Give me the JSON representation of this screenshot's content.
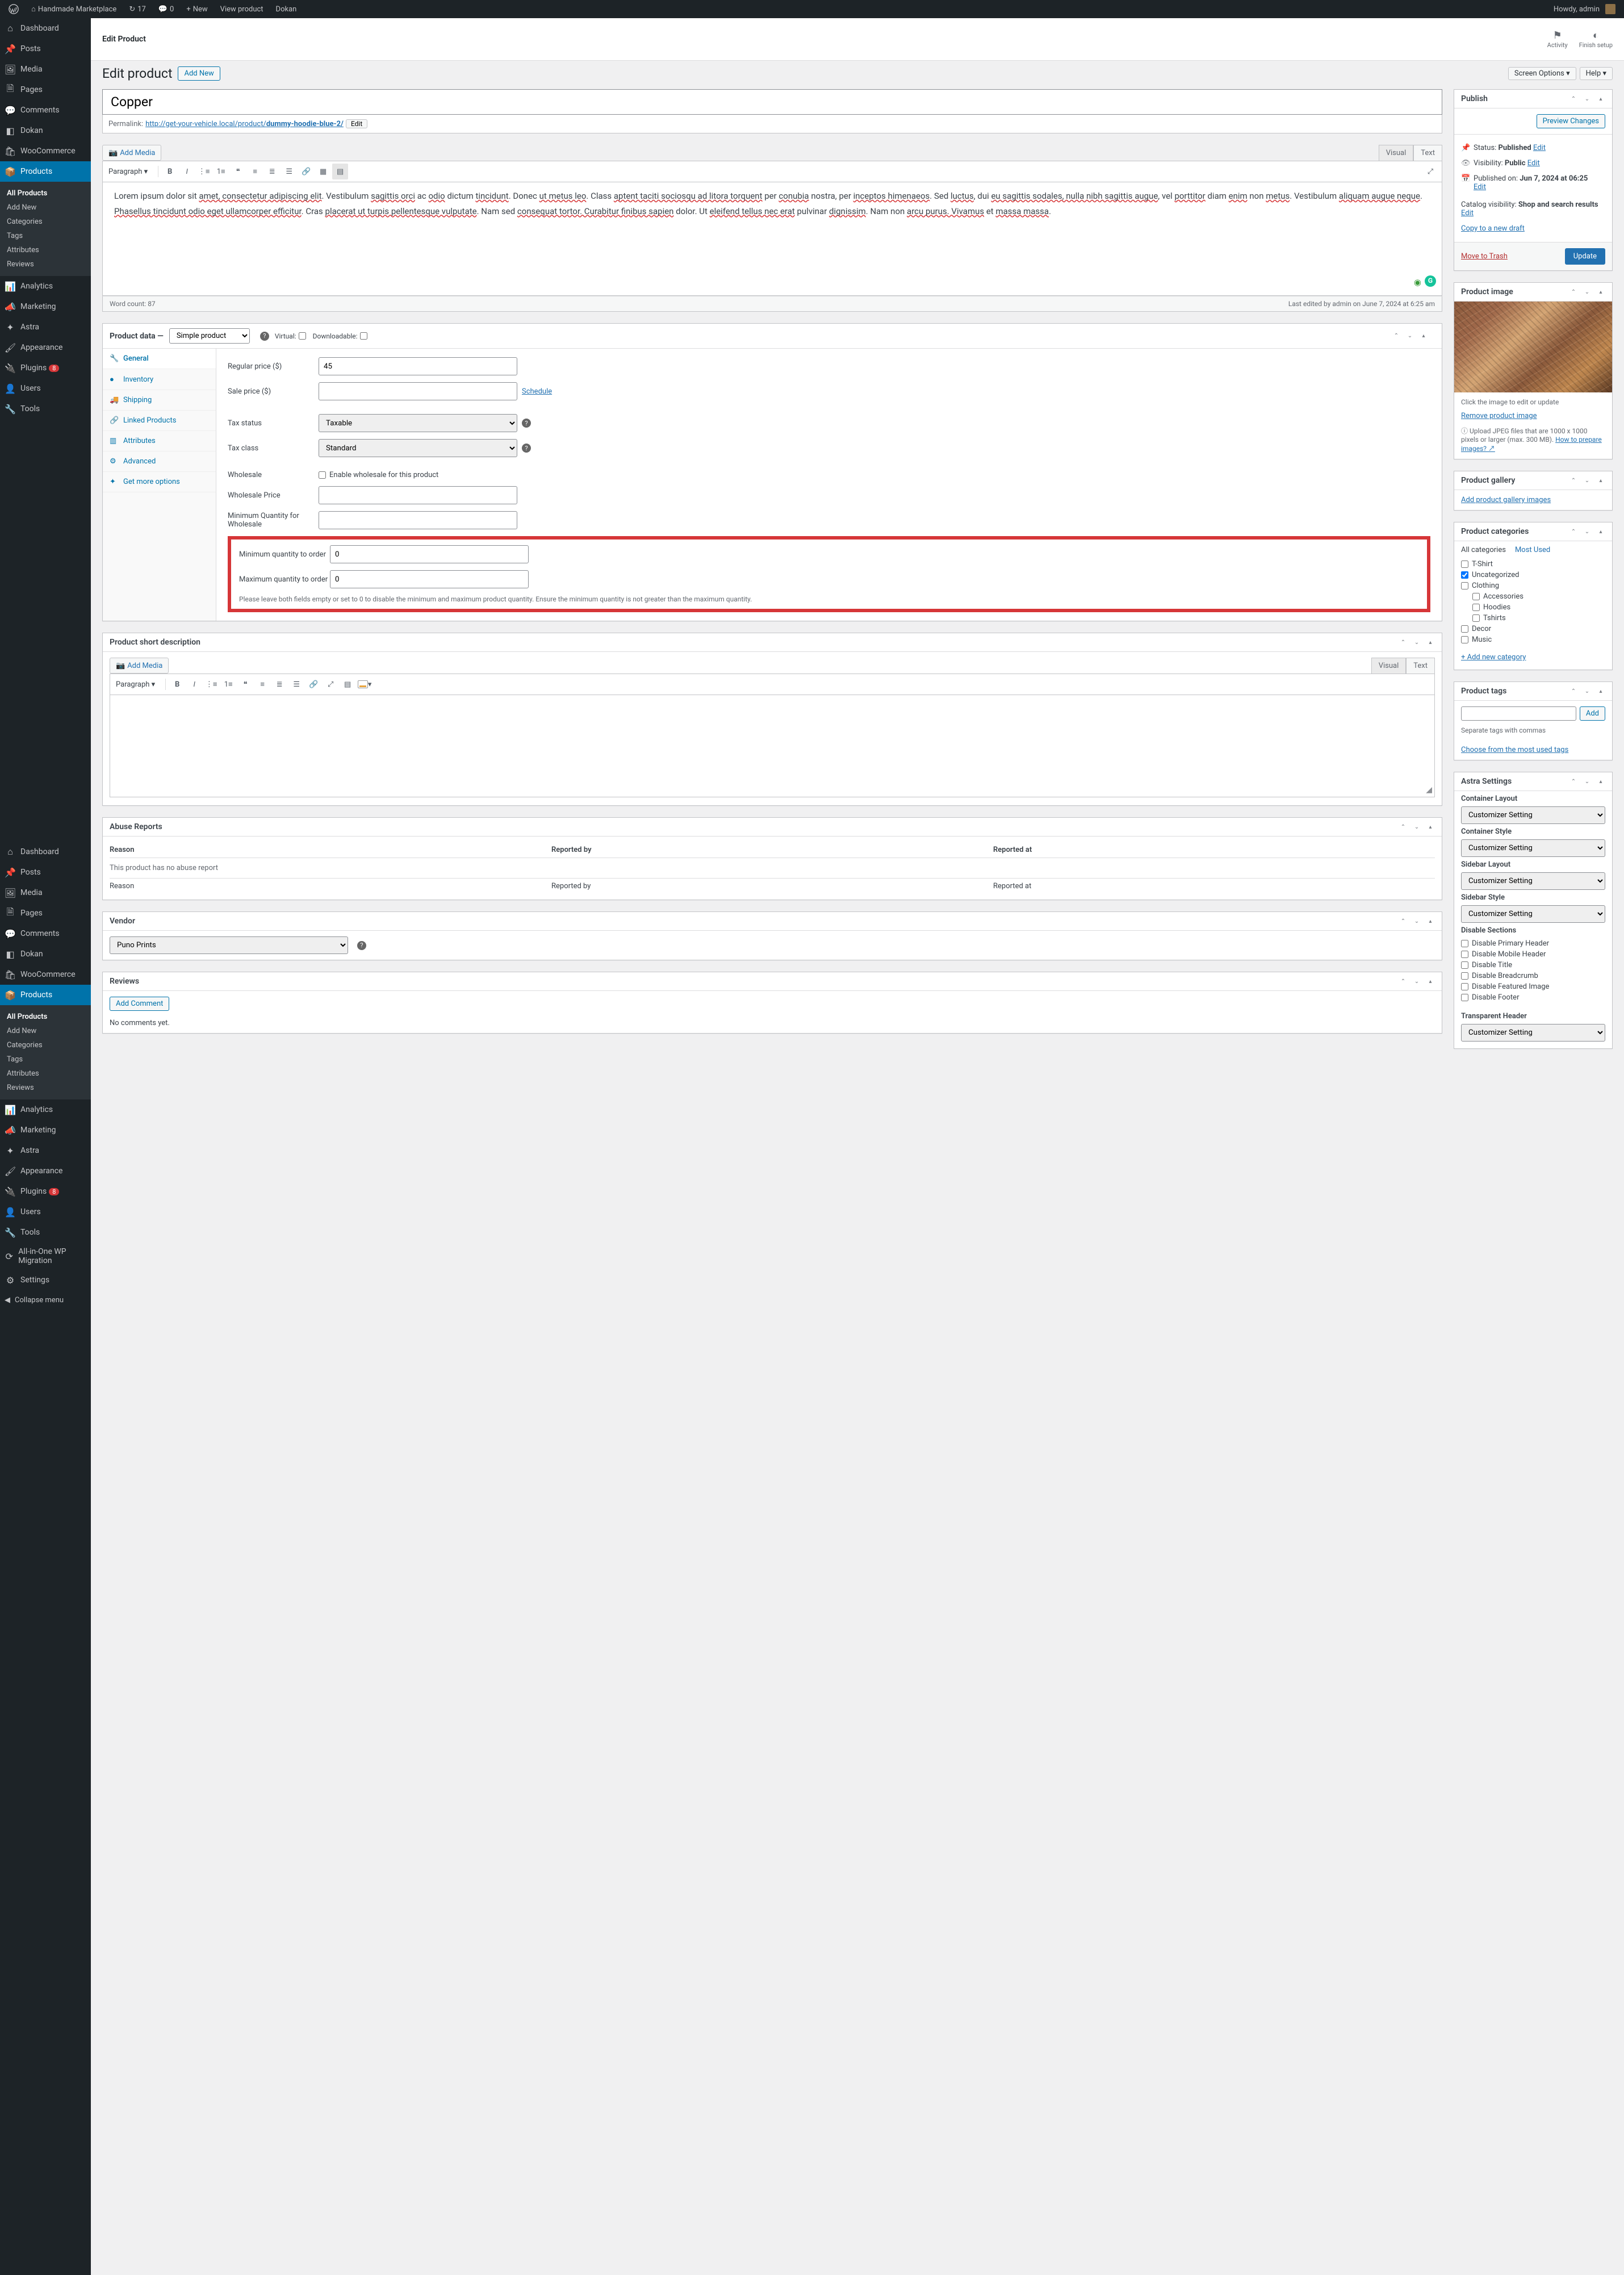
{
  "admin_bar": {
    "site_name": "Handmade Marketplace",
    "updates": "17",
    "comments": "0",
    "new": "New",
    "view_product": "View product",
    "dokan": "Dokan",
    "howdy": "Howdy, admin"
  },
  "sidebar": {
    "items": [
      {
        "label": "Dashboard",
        "icon": "⌂"
      },
      {
        "label": "Posts",
        "icon": "📌"
      },
      {
        "label": "Media",
        "icon": "🖼"
      },
      {
        "label": "Pages",
        "icon": "🗎"
      },
      {
        "label": "Comments",
        "icon": "💬"
      },
      {
        "label": "Dokan",
        "icon": "◧"
      },
      {
        "label": "WooCommerce",
        "icon": "🛍"
      },
      {
        "label": "Products",
        "icon": "📦",
        "current": true,
        "sub": [
          {
            "label": "All Products",
            "current": true
          },
          {
            "label": "Add New"
          },
          {
            "label": "Categories"
          },
          {
            "label": "Tags"
          },
          {
            "label": "Attributes"
          },
          {
            "label": "Reviews"
          }
        ]
      },
      {
        "label": "Analytics",
        "icon": "📊"
      },
      {
        "label": "Marketing",
        "icon": "📣"
      },
      {
        "label": "Astra",
        "icon": "✦"
      },
      {
        "label": "Appearance",
        "icon": "🖌"
      },
      {
        "label": "Plugins",
        "icon": "🔌",
        "badge": "8"
      },
      {
        "label": "Users",
        "icon": "👤"
      },
      {
        "label": "Tools",
        "icon": "🔧"
      }
    ],
    "items2": [
      {
        "label": "Dashboard",
        "icon": "⌂"
      },
      {
        "label": "Posts",
        "icon": "📌"
      },
      {
        "label": "Media",
        "icon": "🖼"
      },
      {
        "label": "Pages",
        "icon": "🗎"
      },
      {
        "label": "Comments",
        "icon": "💬"
      },
      {
        "label": "Dokan",
        "icon": "◧"
      },
      {
        "label": "WooCommerce",
        "icon": "🛍"
      },
      {
        "label": "Products",
        "icon": "📦",
        "current": true,
        "sub": [
          {
            "label": "All Products",
            "current": true
          },
          {
            "label": "Add New"
          },
          {
            "label": "Categories"
          },
          {
            "label": "Tags"
          },
          {
            "label": "Attributes"
          },
          {
            "label": "Reviews"
          }
        ]
      },
      {
        "label": "Analytics",
        "icon": "📊"
      },
      {
        "label": "Marketing",
        "icon": "📣"
      },
      {
        "label": "Astra",
        "icon": "✦"
      },
      {
        "label": "Appearance",
        "icon": "🖌"
      },
      {
        "label": "Plugins",
        "icon": "🔌",
        "badge": "8"
      },
      {
        "label": "Users",
        "icon": "👤"
      },
      {
        "label": "Tools",
        "icon": "🔧"
      },
      {
        "label": "All-in-One WP Migration",
        "icon": "⟳"
      },
      {
        "label": "Settings",
        "icon": "⚙"
      }
    ],
    "collapse": "Collapse menu"
  },
  "topbar": {
    "title": "Edit Product",
    "activity": "Activity",
    "finish_setup": "Finish setup"
  },
  "page": {
    "heading": "Edit product",
    "add_new": "Add New",
    "screen_options": "Screen Options ▾",
    "help": "Help ▾"
  },
  "product": {
    "title": "Copper",
    "permalink_label": "Permalink:",
    "permalink_base": "http://get-your-vehicle.local/product/",
    "permalink_slug": "dummy-hoodie-blue-2/",
    "permalink_edit": "Edit",
    "description": "Lorem ipsum dolor sit amet, consectetur adipiscing elit. Vestibulum sagittis orci ac odio dictum tincidunt. Donec ut metus leo. Class aptent taciti sociosqu ad litora torquent per conubia nostra, per inceptos himenaeos. Sed luctus, dui eu sagittis sodales, nulla nibh sagittis augue, vel porttitor diam enim non metus. Vestibulum aliquam augue neque. Phasellus tincidunt odio eget ullamcorper efficitur. Cras placerat ut turpis pellentesque vulputate. Nam sed consequat tortor. Curabitur finibus sapien dolor. Ut eleifend tellus nec erat pulvinar dignissim. Nam non arcu purus. Vivamus et massa massa."
  },
  "editor": {
    "add_media": "Add Media",
    "visual": "Visual",
    "text": "Text",
    "paragraph": "Paragraph",
    "word_count_label": "Word count: ",
    "word_count": "87",
    "last_edited": "Last edited by admin on June 7, 2024 at 6:25 am"
  },
  "product_data": {
    "title": "Product data —",
    "type": "Simple product",
    "virtual_label": "Virtual:",
    "downloadable_label": "Downloadable:",
    "tabs": {
      "general": "General",
      "inventory": "Inventory",
      "shipping": "Shipping",
      "linked": "Linked Products",
      "attributes": "Attributes",
      "advanced": "Advanced",
      "get_more": "Get more options"
    },
    "fields": {
      "regular_price": "Regular price ($)",
      "regular_price_val": "45",
      "sale_price": "Sale price ($)",
      "schedule": "Schedule",
      "tax_status": "Tax status",
      "tax_status_val": "Taxable",
      "tax_class": "Tax class",
      "tax_class_val": "Standard",
      "wholesale": "Wholesale",
      "wholesale_enable": "Enable wholesale for this product",
      "wholesale_price": "Wholesale Price",
      "min_qty_wholesale": "Minimum Quantity for Wholesale",
      "min_qty_order": "Minimum quantity to order",
      "min_qty_order_val": "0",
      "max_qty_order": "Maximum quantity to order",
      "max_qty_order_val": "0",
      "qty_hint": "Please leave both fields empty or set to 0 to disable the minimum and maximum product quantity. Ensure the minimum quantity is not greater than the maximum quantity."
    }
  },
  "short_desc": {
    "title": "Product short description"
  },
  "abuse": {
    "title": "Abuse Reports",
    "reason": "Reason",
    "reported_by": "Reported by",
    "reported_at": "Reported at",
    "no_report": "This product has no abuse report"
  },
  "vendor": {
    "title": "Vendor",
    "selected": "Puno Prints"
  },
  "reviews": {
    "title": "Reviews",
    "add_comment": "Add Comment",
    "no_comments": "No comments yet."
  },
  "publish": {
    "title": "Publish",
    "preview": "Preview Changes",
    "status_label": "Status: ",
    "status": "Published",
    "edit": "Edit",
    "visibility_label": "Visibility: ",
    "visibility": "Public",
    "published_on_label": "Published on: ",
    "published_on": "Jun 7, 2024 at 06:25",
    "catalog_label": "Catalog visibility: ",
    "catalog": "Shop and search results",
    "copy_draft": "Copy to a new draft",
    "trash": "Move to Trash",
    "update": "Update"
  },
  "product_image": {
    "title": "Product image",
    "click_hint": "Click the image to edit or update",
    "remove": "Remove product image",
    "upload_hint": "Upload JPEG files that are 1000 x 1000 pixels or larger (max. 300 MB). ",
    "how_to": "How to prepare images? ↗"
  },
  "gallery": {
    "title": "Product gallery",
    "add": "Add product gallery images"
  },
  "categories": {
    "title": "Product categories",
    "all": "All categories",
    "most_used": "Most Used",
    "items": [
      {
        "label": "T-Shirt",
        "checked": false,
        "indent": 0
      },
      {
        "label": "Uncategorized",
        "checked": true,
        "indent": 0
      },
      {
        "label": "Clothing",
        "checked": false,
        "indent": 0
      },
      {
        "label": "Accessories",
        "checked": false,
        "indent": 1
      },
      {
        "label": "Hoodies",
        "checked": false,
        "indent": 1
      },
      {
        "label": "Tshirts",
        "checked": false,
        "indent": 1
      },
      {
        "label": "Decor",
        "checked": false,
        "indent": 0
      },
      {
        "label": "Music",
        "checked": false,
        "indent": 0
      }
    ],
    "add_new": "+ Add new category"
  },
  "tags": {
    "title": "Product tags",
    "add": "Add",
    "hint": "Separate tags with commas",
    "choose": "Choose from the most used tags"
  },
  "astra": {
    "title": "Astra Settings",
    "container_layout": "Container Layout",
    "container_style": "Container Style",
    "sidebar_layout": "Sidebar Layout",
    "sidebar_style": "Sidebar Style",
    "customizer": "Customizer Setting",
    "disable_sections": "Disable Sections",
    "disable_items": [
      "Disable Primary Header",
      "Disable Mobile Header",
      "Disable Title",
      "Disable Breadcrumb",
      "Disable Featured Image",
      "Disable Footer"
    ],
    "transparent_header": "Transparent Header"
  }
}
